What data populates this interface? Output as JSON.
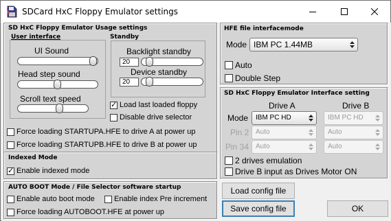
{
  "window": {
    "title": "SDCard HxC Floppy Emulator settings"
  },
  "usage": {
    "heading": "SD HxC Floppy Emulator Usage settings",
    "user_interface": {
      "heading": "User interface",
      "ui_sound": {
        "label": "UI Sound",
        "level": 0.97
      },
      "head_step_sound": {
        "label": "Head step sound",
        "level": 0.5
      },
      "scroll_text_speed": {
        "label": "Scroll text speed",
        "level": 0.55
      }
    },
    "standby": {
      "heading": "Standby",
      "backlight": {
        "label": "Backlight standby",
        "value": "20",
        "level": 0.1
      },
      "device": {
        "label": "Device standby",
        "value": "20",
        "level": 0.1
      }
    },
    "load_last": {
      "label": "Load last loaded floppy",
      "checked": true
    },
    "disable_selector": {
      "label": "Disable drive selector",
      "checked": false
    },
    "force_a": {
      "label": "Force loading STARTUPA.HFE to drive A at power up",
      "checked": false
    },
    "force_b": {
      "label": "Force loading STARTUPB.HFE to drive B at power up",
      "checked": false
    }
  },
  "indexed": {
    "heading": "Indexed Mode",
    "enable": {
      "label": "Enable indexed mode",
      "checked": true
    }
  },
  "autoboot": {
    "heading": "AUTO BOOT Mode / File Selector software startup",
    "enable_autoboot": {
      "label": "Enable auto boot mode",
      "checked": false
    },
    "enable_pre_inc": {
      "label": "Enable index Pre increment",
      "checked": false
    },
    "force_autoboot": {
      "label": "Force loading AUTOBOOT.HFE at power up",
      "checked": false
    }
  },
  "hfe": {
    "heading": "HFE file interfacemode",
    "mode_label": "Mode",
    "mode_value": "IBM PC 1.44MB",
    "auto": {
      "label": "Auto",
      "checked": false
    },
    "double_step": {
      "label": "Double Step",
      "checked": false
    }
  },
  "interface": {
    "heading": "SD HxC Floppy Emulator Interface setting",
    "drive_a": "Drive A",
    "drive_b": "Drive B",
    "rows": {
      "mode": {
        "label": "Mode",
        "a": "IBM PC HD",
        "b": "IBM PC HD"
      },
      "pin2": {
        "label": "Pin 2",
        "a": "Auto",
        "b": "Auto"
      },
      "pin34": {
        "label": "Pin 34",
        "a": "Auto",
        "b": "Auto"
      }
    },
    "two_drives": {
      "label": "2 drives emulation",
      "checked": false
    },
    "drive_b_motor": {
      "label": "Drive B input as Drives Motor ON",
      "checked": false
    }
  },
  "buttons": {
    "load": "Load config file",
    "save": "Save config file",
    "ok": "OK"
  },
  "colors": {
    "panel": "#d4d4d4",
    "window": "#f0f0f0",
    "focus_border": "#3c7fb1"
  }
}
